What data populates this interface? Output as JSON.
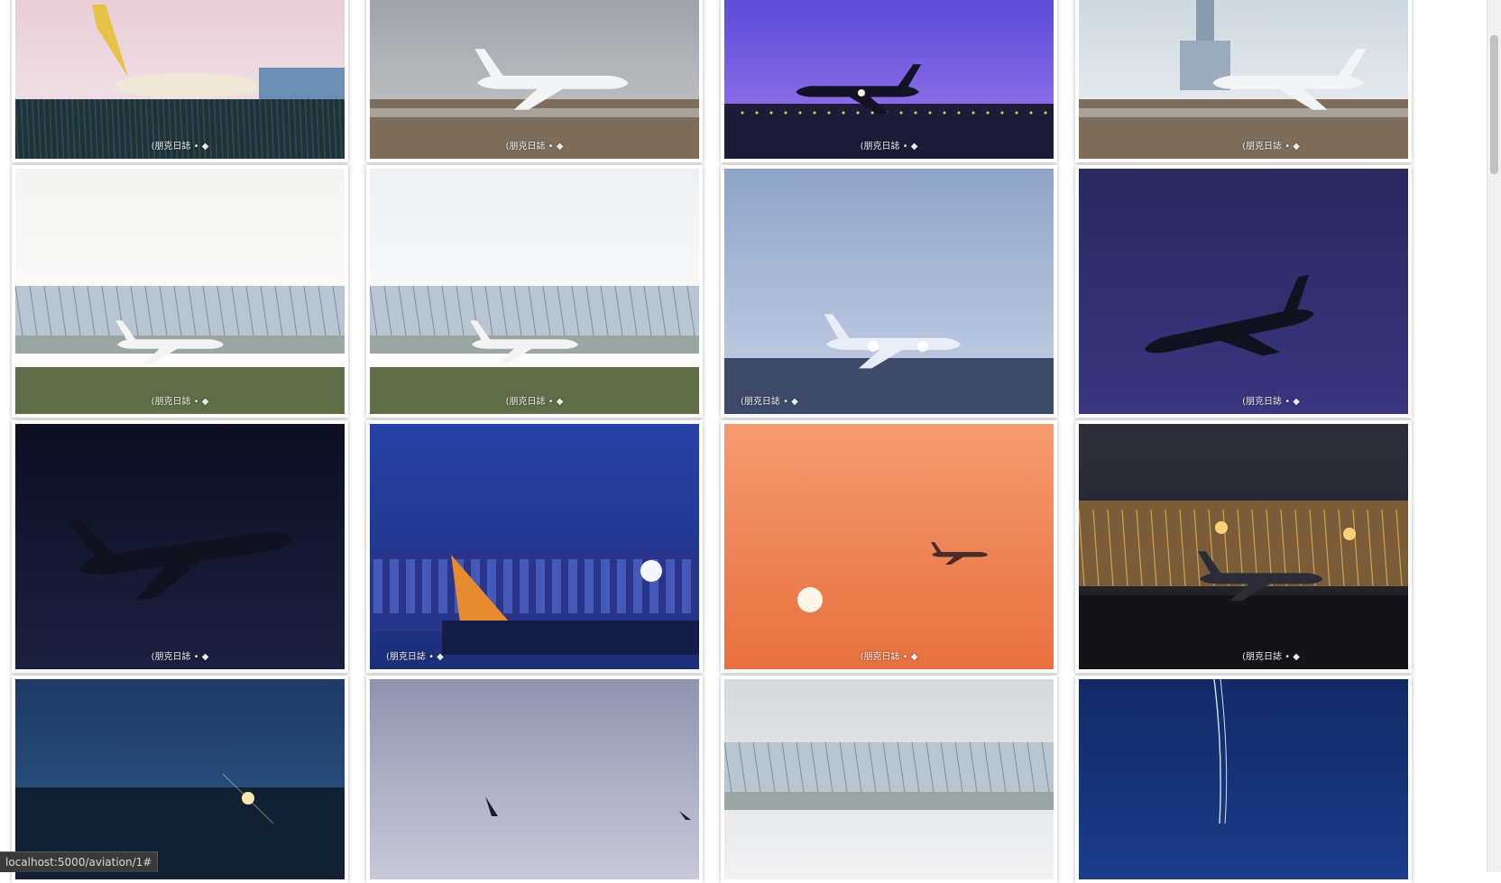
{
  "watermark_text": "(朋克日誌 • ◆",
  "status_bar": {
    "url": "localhost:5000/aviation/1#"
  },
  "scrollbar": {
    "position": 0.04,
    "visible_fraction": 0.16
  },
  "photos": [
    {
      "name": "photo-yellow-cargo-jet",
      "subject": "cargo-plane-taxiing",
      "tone": "dusk-pink",
      "colors": [
        "#e8cfd6",
        "#f2e8ec"
      ],
      "watermark_pos": "center"
    },
    {
      "name": "photo-air-france-777",
      "subject": "airliner-on-runway",
      "tone": "grey-day",
      "colors": [
        "#9fa3a8",
        "#c9cbcd"
      ],
      "watermark_pos": "center"
    },
    {
      "name": "photo-night-takeoff-purple",
      "subject": "airliner-takeoff",
      "tone": "violet-night",
      "colors": [
        "#5b4bd6",
        "#a07cf0"
      ],
      "watermark_pos": "center"
    },
    {
      "name": "photo-united-777-tower",
      "subject": "airliner-near-tower",
      "tone": "hazy-blue",
      "colors": [
        "#cfd8e0",
        "#eef1f4"
      ],
      "watermark_pos": "right"
    },
    {
      "name": "photo-china-southern-737",
      "subject": "airliner-taxiing-terminal",
      "tone": "white-haze",
      "colors": [
        "#f4f4f2",
        "#ffffff"
      ],
      "watermark_pos": "center"
    },
    {
      "name": "photo-fedex-md11",
      "subject": "cargo-plane-terminal",
      "tone": "white-haze",
      "colors": [
        "#eef1f3",
        "#ffffff"
      ],
      "watermark_pos": "center"
    },
    {
      "name": "photo-united-777-lights",
      "subject": "airliner-landing-lights",
      "tone": "blue-grey",
      "colors": [
        "#8fa3c9",
        "#c7d2e6"
      ],
      "watermark_pos": "left"
    },
    {
      "name": "photo-air-china-night-climb",
      "subject": "airliner-climbing",
      "tone": "indigo-night",
      "colors": [
        "#2a2960",
        "#3a3680"
      ],
      "watermark_pos": "right"
    },
    {
      "name": "photo-air-china-a330-night",
      "subject": "widebody-climbing",
      "tone": "black-blue",
      "colors": [
        "#0d1022",
        "#1b2040"
      ],
      "watermark_pos": "center"
    },
    {
      "name": "photo-tail-fin-blue-hour",
      "subject": "tail-at-terminal",
      "tone": "deep-blue",
      "colors": [
        "#2741a8",
        "#1d2f7a"
      ],
      "watermark_pos": "left"
    },
    {
      "name": "photo-sunset-orange",
      "subject": "plane-and-sun",
      "tone": "orange-sunset",
      "colors": [
        "#f59a6e",
        "#e8703e"
      ],
      "watermark_pos": "center"
    },
    {
      "name": "photo-terminal-night-lights",
      "subject": "widebody-at-terminal",
      "tone": "amber-night",
      "colors": [
        "#2c2f3a",
        "#1c1c22"
      ],
      "watermark_pos": "right"
    },
    {
      "name": "photo-runway-glow-dusk",
      "subject": "runway-lights",
      "tone": "teal-dusk",
      "colors": [
        "#1e3b66",
        "#2e5a8a"
      ],
      "watermark_pos": "center"
    },
    {
      "name": "photo-grey-dusk-tail",
      "subject": "airliner-at-dusk",
      "tone": "lavender-grey",
      "colors": [
        "#8f93ad",
        "#c8c9d8"
      ],
      "watermark_pos": "center"
    },
    {
      "name": "photo-terminal-roof",
      "subject": "terminal-roof-arches",
      "tone": "silver-day",
      "colors": [
        "#d6d9dc",
        "#f0f1f2"
      ],
      "watermark_pos": "center"
    },
    {
      "name": "photo-light-trails",
      "subject": "light-trails-night",
      "tone": "navy-night",
      "colors": [
        "#112a66",
        "#1b3d8a"
      ],
      "watermark_pos": "center"
    }
  ]
}
